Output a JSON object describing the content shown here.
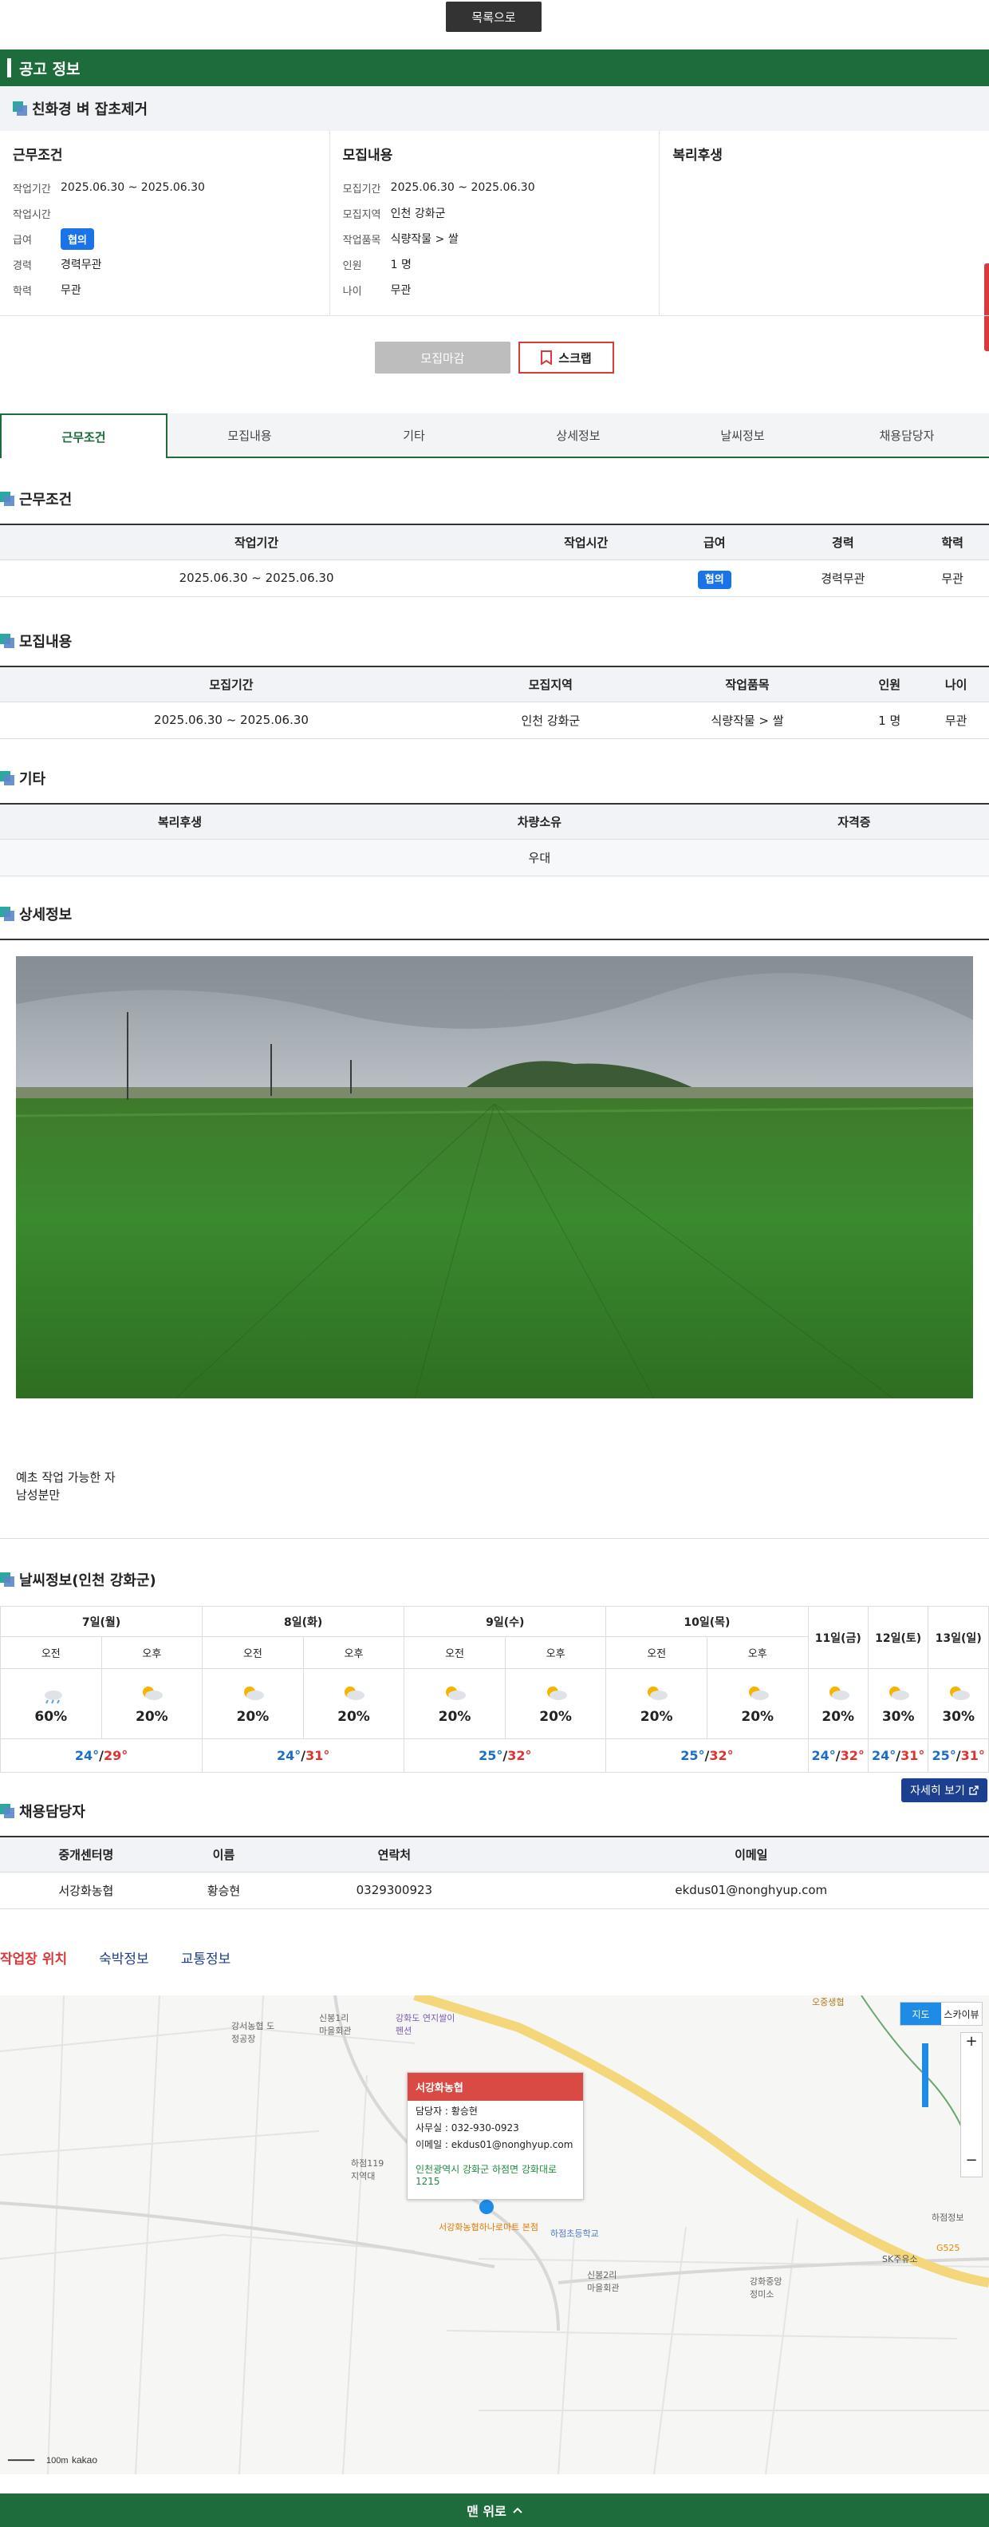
{
  "top": {
    "list_button": "목록으로"
  },
  "header": {
    "title": "공고 정보"
  },
  "post": {
    "title": "친화경 벼 잡초제거"
  },
  "summary": {
    "work": {
      "heading": "근무조건",
      "rows": [
        {
          "k": "작업기간",
          "v": "2025.06.30 ~ 2025.06.30"
        },
        {
          "k": "작업시간",
          "v": ""
        },
        {
          "k": "급여",
          "v": "협의"
        },
        {
          "k": "경력",
          "v": "경력무관"
        },
        {
          "k": "학력",
          "v": "무관"
        }
      ]
    },
    "recruit": {
      "heading": "모집내용",
      "rows": [
        {
          "k": "모집기간",
          "v": "2025.06.30 ~ 2025.06.30"
        },
        {
          "k": "모집지역",
          "v": "인천 강화군"
        },
        {
          "k": "작업품목",
          "v": "식량작물 > 쌀"
        },
        {
          "k": "인원",
          "v": "1 명"
        },
        {
          "k": "나이",
          "v": "무관"
        }
      ]
    },
    "welfare": {
      "heading": "복리후생"
    }
  },
  "actions": {
    "closed": "모집마감",
    "scrap": "스크랩"
  },
  "tabs": [
    "근무조건",
    "모집내용",
    "기타",
    "상세정보",
    "날씨정보",
    "채용담당자"
  ],
  "sections": {
    "work": {
      "title": "근무조건",
      "headers": [
        "작업기간",
        "작업시간",
        "급여",
        "경력",
        "학력"
      ],
      "row": [
        "2025.06.30 ~ 2025.06.30",
        "",
        "협의",
        "경력무관",
        "무관"
      ]
    },
    "recruit": {
      "title": "모집내용",
      "headers": [
        "모집기간",
        "모집지역",
        "작업품목",
        "인원",
        "나이"
      ],
      "row": [
        "2025.06.30 ~ 2025.06.30",
        "인천 강화군",
        "식량작물 > 쌀",
        "1 명",
        "무관"
      ]
    },
    "etc": {
      "title": "기타",
      "headers": [
        "복리후생",
        "차량소유",
        "자격증"
      ],
      "row": [
        "",
        "우대",
        ""
      ]
    },
    "detail": {
      "title": "상세정보",
      "lines": [
        "예초 작업 가능한 자",
        "남성분만"
      ]
    },
    "weather": {
      "title": "날씨정보(인천 강화군)",
      "days2": [
        "7일(월)",
        "8일(화)",
        "9일(수)",
        "10일(목)"
      ],
      "days1": [
        "11일(금)",
        "12일(토)",
        "13일(일)"
      ],
      "am": "오전",
      "pm": "오후",
      "probs": [
        "60%",
        "20%",
        "20%",
        "20%",
        "20%",
        "20%",
        "20%",
        "20%",
        "20%",
        "30%",
        "30%"
      ],
      "temps": [
        [
          "24°",
          "29°"
        ],
        [
          "24°",
          "31°"
        ],
        [
          "25°",
          "32°"
        ],
        [
          "25°",
          "32°"
        ],
        [
          "24°",
          "32°"
        ],
        [
          "24°",
          "31°"
        ],
        [
          "25°",
          "31°"
        ]
      ],
      "more": "자세히 보기"
    },
    "contact": {
      "title": "채용담당자",
      "headers": [
        "중개센터명",
        "이름",
        "연락처",
        "이메일"
      ],
      "row": [
        "서강화농협",
        "황승현",
        "0329300923",
        "ekdus01@nonghyup.com"
      ]
    }
  },
  "location_tabs": [
    "작업장 위치",
    "숙박정보",
    "교통정보"
  ],
  "map": {
    "popup": {
      "title": "서강화농협",
      "manager": "담당자 : 황승현",
      "office": "사무실 : 032-930-0923",
      "email": "이메일 : ekdus01@nonghyup.com",
      "address": "인천광역시 강화군 하점면 강화대로 1215"
    },
    "type_map": "지도",
    "type_sky": "스카이뷰",
    "labels": [
      "신봉1리 마을회관",
      "강화도 연지쌀이펜션",
      "강서농협 도정공장",
      "하점119 지역대",
      "하점초등학교",
      "신봉2리 마을회관",
      "강화중앙 정미소",
      "SK주유소",
      "G525",
      "하점정보",
      "오중생협",
      "서강화농협하나로마트 본점"
    ],
    "scale": "100m",
    "brand": "kakao"
  },
  "footer": {
    "top": "맨 위로"
  }
}
